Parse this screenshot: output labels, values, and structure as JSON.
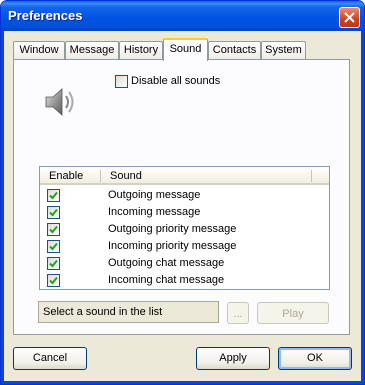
{
  "window": {
    "title": "Preferences"
  },
  "tabs": [
    {
      "label": "Window"
    },
    {
      "label": "Message"
    },
    {
      "label": "History"
    },
    {
      "label": "Sound",
      "active": true
    },
    {
      "label": "Contacts"
    },
    {
      "label": "System"
    }
  ],
  "sound": {
    "disable_all_label": "Disable all sounds",
    "disable_all_checked": false,
    "icon": "speaker-icon",
    "list": {
      "columns": [
        "Enable",
        "Sound"
      ],
      "rows": [
        {
          "enabled": true,
          "label": "Outgoing message"
        },
        {
          "enabled": true,
          "label": "Incoming message"
        },
        {
          "enabled": true,
          "label": "Outgoing priority message"
        },
        {
          "enabled": true,
          "label": "Incoming priority message"
        },
        {
          "enabled": true,
          "label": "Outgoing chat message"
        },
        {
          "enabled": true,
          "label": "Incoming chat message"
        }
      ]
    },
    "status_text": "Select a sound in the list",
    "browse_label": "...",
    "play_label": "Play"
  },
  "footer": {
    "cancel_label": "Cancel",
    "apply_label": "Apply",
    "ok_label": "OK"
  },
  "colors": {
    "titlebar": "#0054e3",
    "dialog_bg": "#ece9d8",
    "active_tab_accent": "#ffc83c",
    "close_button": "#d1401e",
    "checkmark": "#21a121"
  }
}
